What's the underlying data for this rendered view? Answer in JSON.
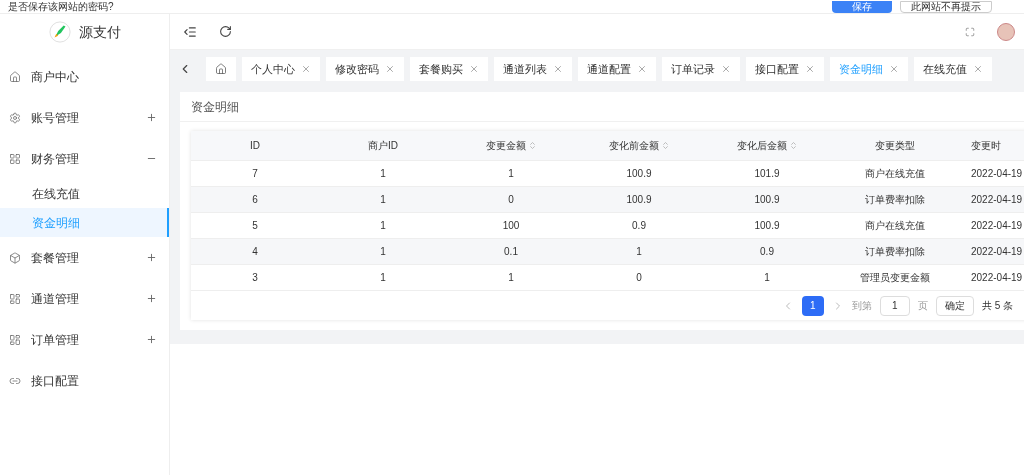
{
  "browser_prompt": {
    "text": "是否保存该网站的密码?",
    "buttons": [
      {
        "label": "保存",
        "kind": "primary"
      },
      {
        "label": "此网站不再提示",
        "kind": "plain"
      }
    ]
  },
  "brand": {
    "name": "源支付"
  },
  "sidebar": {
    "items": [
      {
        "label": "商户中心"
      },
      {
        "label": "账号管理",
        "expanded": false
      },
      {
        "label": "财务管理",
        "expanded": true,
        "children": [
          {
            "label": "在线充值",
            "selected": false
          },
          {
            "label": "资金明细",
            "selected": true
          }
        ]
      },
      {
        "label": "套餐管理",
        "expanded": false
      },
      {
        "label": "通道管理",
        "expanded": false
      },
      {
        "label": "订单管理",
        "expanded": false
      },
      {
        "label": "接口配置"
      }
    ]
  },
  "tabs": [
    {
      "label": "个人中心",
      "selected": false
    },
    {
      "label": "修改密码",
      "selected": false
    },
    {
      "label": "套餐购买",
      "selected": false
    },
    {
      "label": "通道列表",
      "selected": false
    },
    {
      "label": "通道配置",
      "selected": false
    },
    {
      "label": "订单记录",
      "selected": false
    },
    {
      "label": "接口配置",
      "selected": false
    },
    {
      "label": "资金明细",
      "selected": true
    },
    {
      "label": "在线充值",
      "selected": false
    }
  ],
  "card": {
    "title": "资金明细"
  },
  "table": {
    "columns": [
      {
        "label": "ID",
        "sortable": false
      },
      {
        "label": "商户ID",
        "sortable": false
      },
      {
        "label": "变更金额",
        "sortable": true
      },
      {
        "label": "变化前金额",
        "sortable": true
      },
      {
        "label": "变化后金额",
        "sortable": true
      },
      {
        "label": "变更类型",
        "sortable": false
      },
      {
        "label": "变更时",
        "sortable": false
      }
    ],
    "rows": [
      [
        "7",
        "1",
        "1",
        "100.9",
        "101.9",
        "商户在线充值",
        "2022-04-19"
      ],
      [
        "6",
        "1",
        "0",
        "100.9",
        "100.9",
        "订单费率扣除",
        "2022-04-19"
      ],
      [
        "5",
        "1",
        "100",
        "0.9",
        "100.9",
        "商户在线充值",
        "2022-04-19"
      ],
      [
        "4",
        "1",
        "0.1",
        "1",
        "0.9",
        "订单费率扣除",
        "2022-04-19"
      ],
      [
        "3",
        "1",
        "1",
        "0",
        "1",
        "管理员变更金额",
        "2022-04-19"
      ]
    ]
  },
  "pagination": {
    "pages": [
      {
        "label": "1",
        "selected": true
      }
    ],
    "goto_label": "到第",
    "page_input": "1",
    "page_unit": "页",
    "confirm": "确定",
    "total": "共 5 条"
  }
}
